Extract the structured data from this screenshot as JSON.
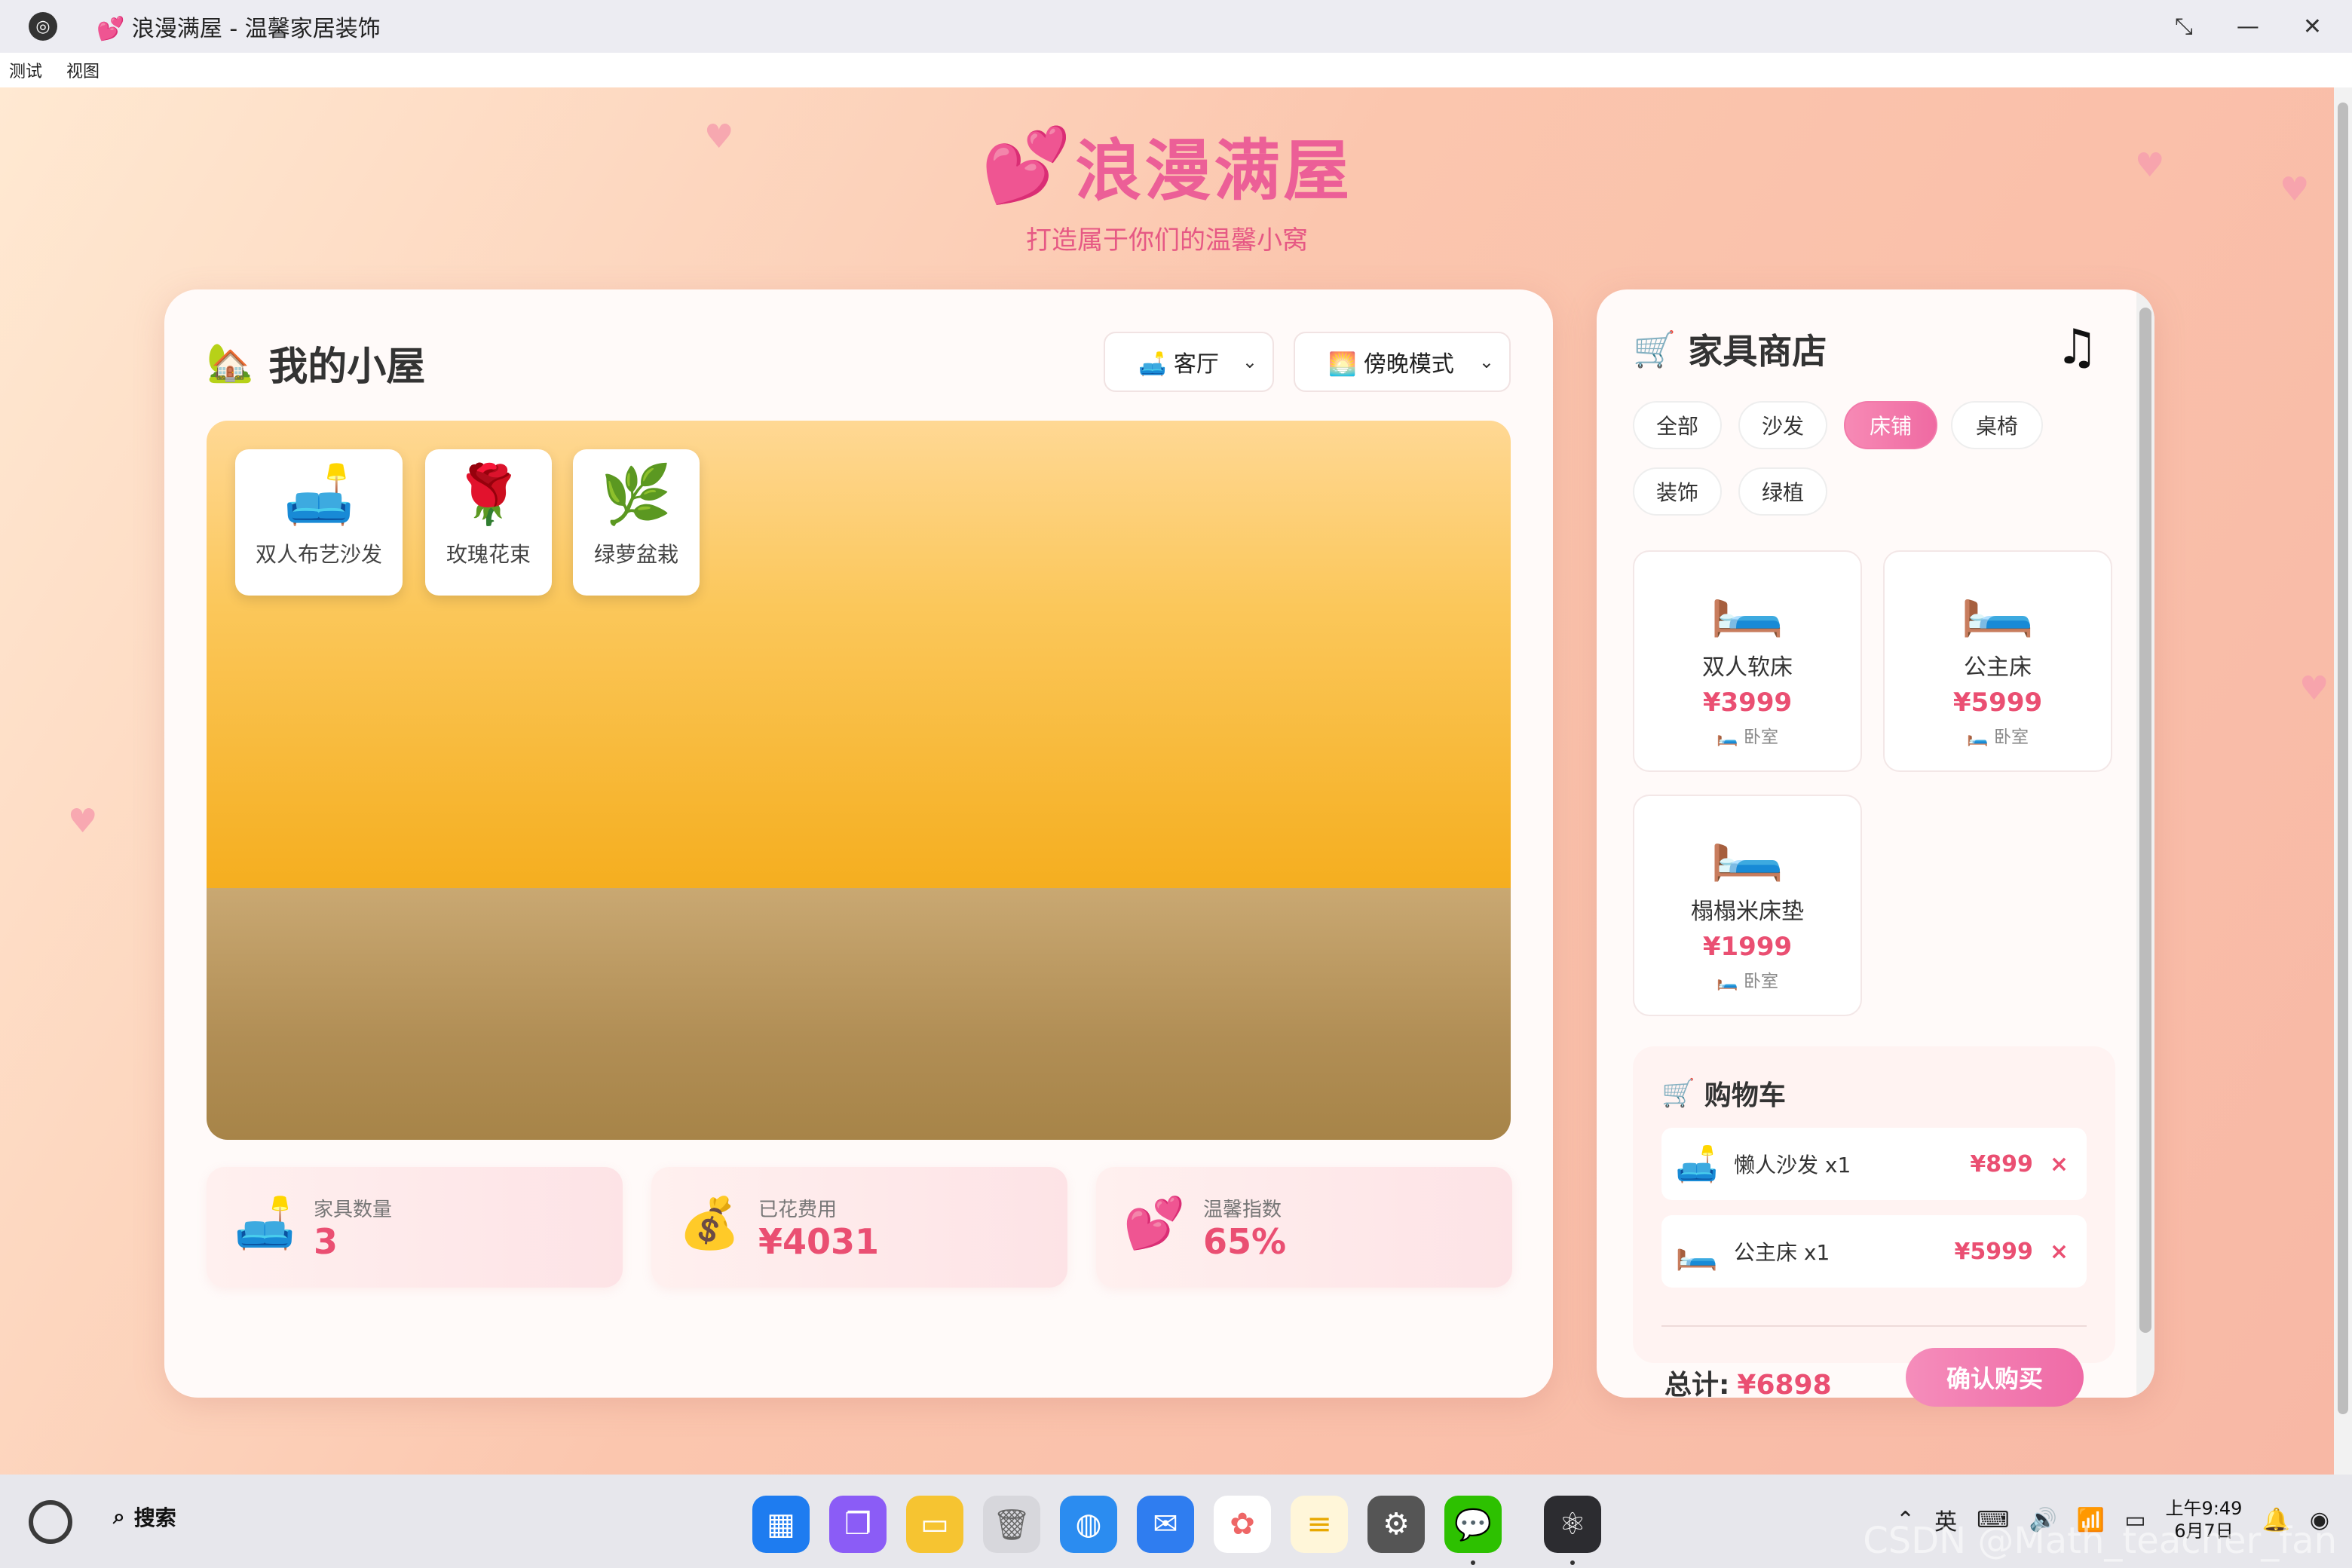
{
  "window": {
    "title": "💕 浪漫满屋 - 温馨家居装饰",
    "controls": [
      "⤡",
      "—",
      "✕"
    ]
  },
  "menu": [
    "测试",
    "视图"
  ],
  "header": {
    "title": "浪漫满屋",
    "subtitle": "打造属于你们的温馨小窝"
  },
  "room": {
    "title": "我的小屋",
    "room_select": "🛋️ 客厅",
    "mode_select": "🌅 傍晚模式",
    "placed": [
      {
        "emoji": "🛋️",
        "label": "双人布艺沙发"
      },
      {
        "emoji": "🌹",
        "label": "玫瑰花束"
      },
      {
        "emoji": "🌿",
        "label": "绿萝盆栽"
      }
    ],
    "stats": [
      {
        "emoji": "🛋️",
        "label": "家具数量",
        "value": "3"
      },
      {
        "emoji": "💰",
        "label": "已花费用",
        "value": "¥4031"
      },
      {
        "emoji": "💕",
        "label": "温馨指数",
        "value": "65%"
      }
    ]
  },
  "shop": {
    "title": "家具商店",
    "categories": [
      "全部",
      "沙发",
      "床铺",
      "桌椅",
      "装饰",
      "绿植"
    ],
    "active_category": "床铺",
    "products": [
      {
        "emoji": "🛏️",
        "name": "双人软床",
        "price": "¥3999",
        "category": "🛏️ 卧室"
      },
      {
        "emoji": "🛏️",
        "name": "公主床",
        "price": "¥5999",
        "category": "🛏️ 卧室"
      },
      {
        "emoji": "🛏️",
        "name": "榻榻米床垫",
        "price": "¥1999",
        "category": "🛏️ 卧室"
      }
    ],
    "cart": {
      "title": "购物车",
      "items": [
        {
          "emoji": "🛋️",
          "name": "懒人沙发 x1",
          "price": "¥899",
          "remove": "×"
        },
        {
          "emoji": "🛏️",
          "name": "公主床 x1",
          "price": "¥5999",
          "remove": "×"
        }
      ],
      "total_label": "总计:",
      "total_value": "¥6898",
      "buy_label": "确认购买"
    }
  },
  "taskbar": {
    "search_label": "搜索",
    "apps": [
      "launcher",
      "multitask",
      "files",
      "trash",
      "browser",
      "mail",
      "photos",
      "notes",
      "settings",
      "wechat",
      "app"
    ],
    "clock_time": "上午9:49",
    "clock_date": "6月7日",
    "watermark": "CSDN @Math_teacher_fan"
  },
  "colors": {
    "accent": "#ec5f97",
    "price": "#ea4f72"
  }
}
